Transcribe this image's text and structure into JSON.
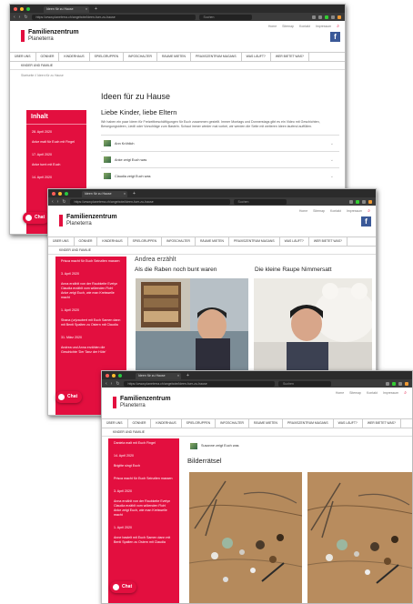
{
  "browser": {
    "tab_title": "Ideen für zu Hause",
    "url": "https://www.planeterra.ch/angebote/ideen-fuer-zu-hause",
    "search_placeholder": "Suchen"
  },
  "site": {
    "logo_line1": "Familienzentrum",
    "logo_line2": "Planeterra",
    "top_links": [
      "Home",
      "Sitemap",
      "Kontakt",
      "Impressum"
    ],
    "nav": [
      "ÜBER UNS",
      "GÖNNER",
      "KINDERHAUS",
      "SPIELGRUPPEN",
      "INFOSCHALTER",
      "RÄUME MIETEN",
      "PRAXISZENTRUM MAGANS",
      "WAS LÄUFT?",
      "WER BIETET WAS?"
    ],
    "subnav": "KINDER UND FAMILIE",
    "chat_label": "Chat",
    "accent": "#e30f3f",
    "facebook": "f"
  },
  "window1": {
    "breadcrumb": "Startseite // Ideen für zu Hause",
    "sidebar_title": "Inhalt",
    "sidebar_items": [
      {
        "date": "28. April 2020",
        "text": "Anke malt für Euch mit Fingel"
      },
      {
        "date": "17. April 2020",
        "text": "Anke turnt mit Euch"
      },
      {
        "date": "14. April 2020",
        "text": ""
      }
    ],
    "page_title": "Ideen für zu Hause",
    "greeting": "Liebe Kinder, liebe Eltern",
    "intro": "Wir haben ein paar Ideen für Freizeitbeschäftigungen für Euch zusammen gestellt. Immer Montags und Donnerstags gibt es ein Video mit Geschichten, Bewegungsideen, Liedli oder Vorschläge zum Basteln. Schaut immer wieder mal vorbei, wir werden die Seite mit weiteren Ideen laufend auffüllen.",
    "accordion": [
      "Ann Kröhlich",
      "Anke zeigt Euch was",
      "Claudia zeigt Euch was"
    ]
  },
  "window2": {
    "sidebar_items": [
      {
        "date": "",
        "text": "Prisca macht für Euch Seinziten massen"
      },
      {
        "date": "3. April 2020",
        "text": "Anna erzählt von der Raubkeite Evelyn Claudia erzählt vom wütenden Floh! Anke zeigt Euch, wie man Kreiswelle macht"
      },
      {
        "date": "1. April 2020",
        "text": "Shana (ur)zaubert mit Euch Samen dann mit Benti Spalten zu Ostern mit Claudia"
      },
      {
        "date": "31. März 2020",
        "text": "Andrea und Anna erzählen die Geschichte 'Der Tanz der Hüte'"
      }
    ],
    "section_title": "Andrea erzählt",
    "video1_title": "Als die Raben noch bunt waren",
    "video2_title": "Die kleine Raupe Nimmersatt"
  },
  "window3": {
    "sidebar_items": [
      {
        "date": "",
        "text": "Daniela malt mit Euch Fingel"
      },
      {
        "date": "14. April 2020",
        "text": "Brigitte singt Euch"
      },
      {
        "date": "",
        "text": "Prisca macht für Euch Seinziten massen"
      },
      {
        "date": "3. April 2020",
        "text": "Anna erzählt von der Raubkeite Evelyn Claudia erzählt vom wütenden Floh! Anke zeigt Euch, wie man Kreiswelle macht"
      },
      {
        "date": "1. April 2020",
        "text": "Anne bastelt mit Euch Samen dann mit Benti Spalten zu Ostern mit Claudia"
      }
    ],
    "accordion_item": "Susanne zeigt Euch was",
    "section_title": "Bilderrätsel"
  }
}
